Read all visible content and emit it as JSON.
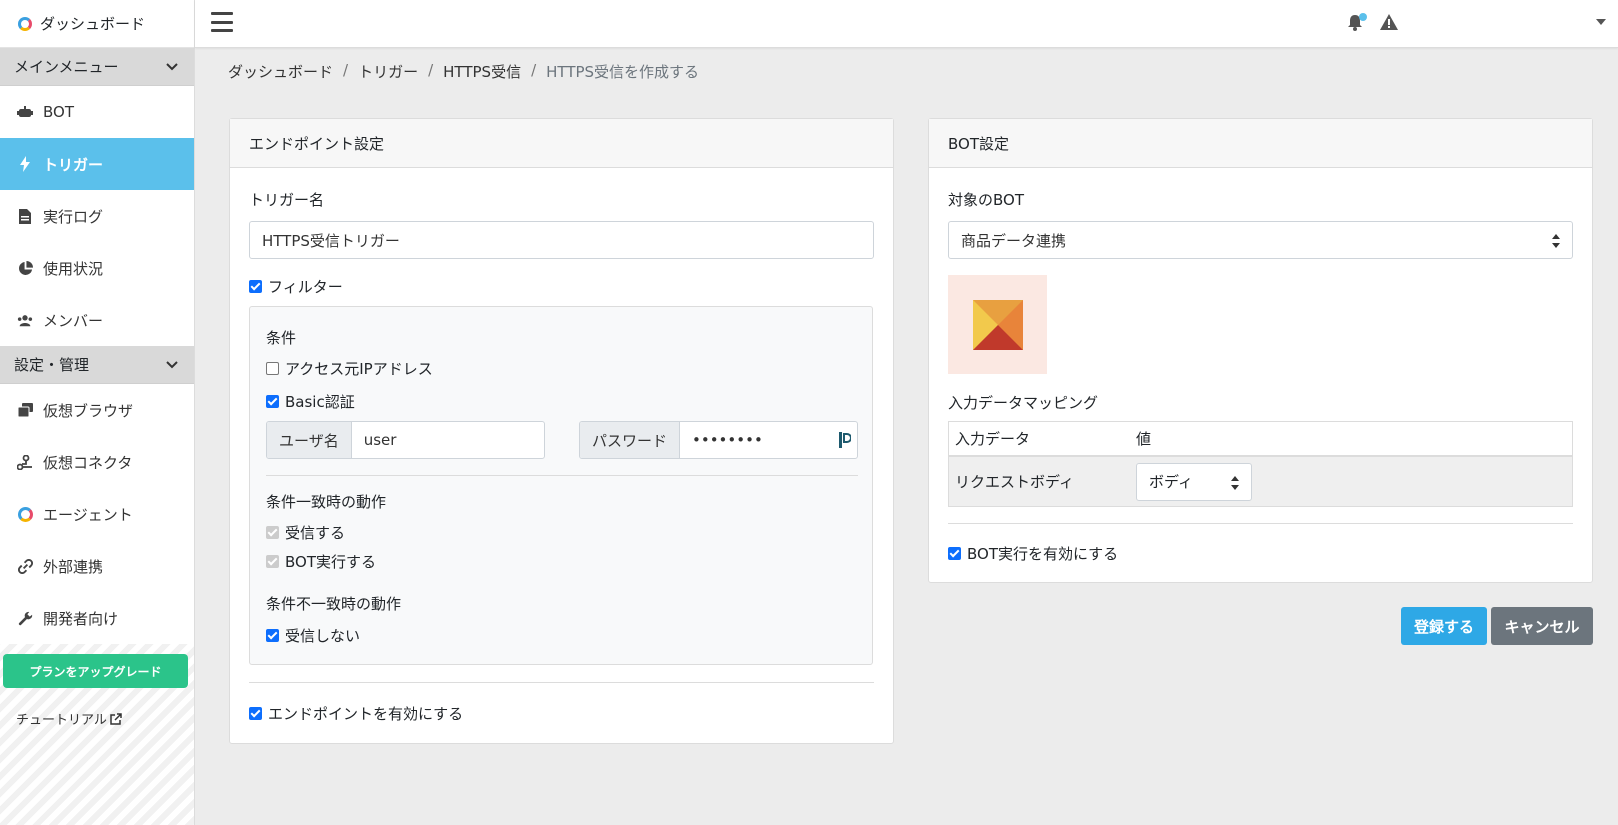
{
  "sidebar": {
    "top_label": "ダッシュボード",
    "sections": [
      {
        "label": "メインメニュー"
      },
      {
        "label": "設定・管理"
      }
    ],
    "items": [
      {
        "label": "BOT",
        "icon": "robot-icon"
      },
      {
        "label": "トリガー",
        "icon": "bolt-icon"
      },
      {
        "label": "実行ログ",
        "icon": "file-icon"
      },
      {
        "label": "使用状況",
        "icon": "pie-chart-icon"
      },
      {
        "label": "メンバー",
        "icon": "users-icon"
      },
      {
        "label": "仮想ブラウザ",
        "icon": "windows-icon"
      },
      {
        "label": "仮想コネクタ",
        "icon": "connector-icon"
      },
      {
        "label": "エージェント",
        "icon": "agent-icon"
      },
      {
        "label": "外部連携",
        "icon": "link-icon"
      },
      {
        "label": "開発者向け",
        "icon": "wrench-icon"
      }
    ],
    "upgrade_label": "プランをアップグレード",
    "tutorial_label": "チュートリアル"
  },
  "breadcrumb": [
    "ダッシュボード",
    "トリガー",
    "HTTPS受信",
    "HTTPS受信を作成する"
  ],
  "endpoint": {
    "title": "エンドポイント設定",
    "trigger_name_label": "トリガー名",
    "trigger_name_value": "HTTPS受信トリガー",
    "filter_label": "フィルター",
    "conditions_label": "条件",
    "ip_label": "アクセス元IPアドレス",
    "basic_auth_label": "Basic認証",
    "username_label": "ユーザ名",
    "username_value": "user",
    "password_label": "パスワード",
    "password_value": "••••••••",
    "match_action_label": "条件一致時の動作",
    "receive_label": "受信する",
    "run_bot_label": "BOT実行する",
    "mismatch_action_label": "条件不一致時の動作",
    "not_receive_label": "受信しない",
    "enable_endpoint_label": "エンドポイントを有効にする"
  },
  "bot": {
    "title": "BOT設定",
    "target_label": "対象のBOT",
    "target_value": "商品データ連携",
    "mapping_label": "入力データマッピング",
    "mapping_header_input": "入力データ",
    "mapping_header_value": "値",
    "mapping_row_label": "リクエストボディ",
    "mapping_row_value": "ボディ",
    "enable_bot_label": "BOT実行を有効にする"
  },
  "actions": {
    "register_label": "登録する",
    "cancel_label": "キャンセル"
  },
  "colors": {
    "accent": "#5bc0eb",
    "primary_button": "#2ea8e6",
    "upgrade_button": "#2bc48a",
    "cancel_button": "#6c757d"
  }
}
